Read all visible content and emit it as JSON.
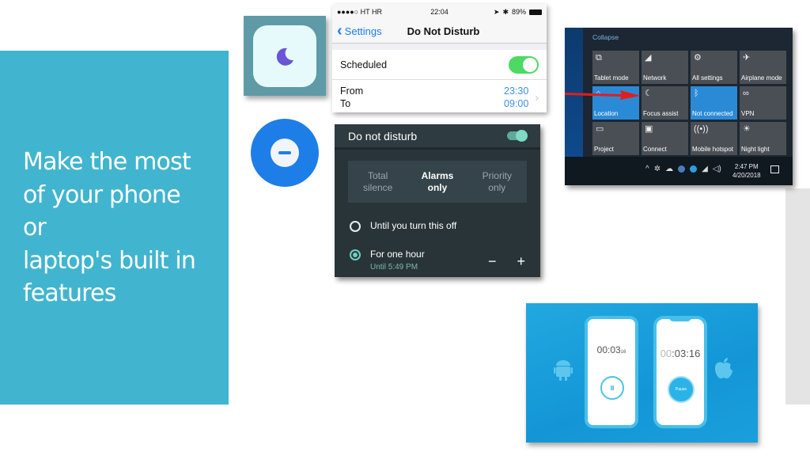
{
  "slide": {
    "title_lines": [
      "Make the most",
      "of your phone",
      "or",
      "laptop's built in",
      "features"
    ],
    "accent_color": "#41b5cf"
  },
  "ios_icon": {
    "icon": "crescent-moon-icon",
    "moon_color": "#6a55d6"
  },
  "android_icon": {
    "icon": "do-not-disturb-minus-icon",
    "color": "#1d7ee8"
  },
  "ios_settings": {
    "status": {
      "carrier": "●●●●○ HT HR",
      "time": "22:04",
      "battery": "89%"
    },
    "back_label": "Settings",
    "title": "Do Not Disturb",
    "scheduled_label": "Scheduled",
    "scheduled_on": true,
    "from_label": "From",
    "to_label": "To",
    "from_value": "23:30",
    "to_value": "09:00"
  },
  "android_dnd": {
    "title": "Do not disturb",
    "enabled": true,
    "tabs": [
      {
        "label_1": "Total",
        "label_2": "silence",
        "active": false
      },
      {
        "label_1": "Alarms",
        "label_2": "only",
        "active": true
      },
      {
        "label_1": "Priority",
        "label_2": "only",
        "active": false
      }
    ],
    "option_1": "Until you turn this off",
    "option_2": "For one hour",
    "option_2_sub": "Until 5:49 PM",
    "minus": "−",
    "plus": "+"
  },
  "windows_action_center": {
    "collapse_label": "Collapse",
    "tiles": [
      {
        "label": "Tablet mode",
        "icon": "⧉",
        "active": false
      },
      {
        "label": "Network",
        "icon": "◢",
        "active": false
      },
      {
        "label": "All settings",
        "icon": "⚙",
        "active": false
      },
      {
        "label": "Airplane mode",
        "icon": "✈",
        "active": false
      },
      {
        "label": "Location",
        "icon": "⌂",
        "active": true
      },
      {
        "label": "Focus assist",
        "icon": "☾",
        "active": false
      },
      {
        "label": "Not connected",
        "icon": "ᛒ",
        "active": true
      },
      {
        "label": "VPN",
        "icon": "∞",
        "active": false
      },
      {
        "label": "Project",
        "icon": "▭",
        "active": false
      },
      {
        "label": "Connect",
        "icon": "▣",
        "active": false
      },
      {
        "label": "Mobile hotspot",
        "icon": "((•))",
        "active": false
      },
      {
        "label": "Night light",
        "icon": "☀",
        "active": false
      }
    ],
    "clock_time": "2:47 PM",
    "clock_date": "4/20/2018"
  },
  "timer_promo": {
    "android_time": "00:03",
    "android_time_fraction": "16",
    "ios_time_dim": "00",
    "ios_time": ":03:16",
    "android_button": "II",
    "ios_button": "Pause"
  }
}
